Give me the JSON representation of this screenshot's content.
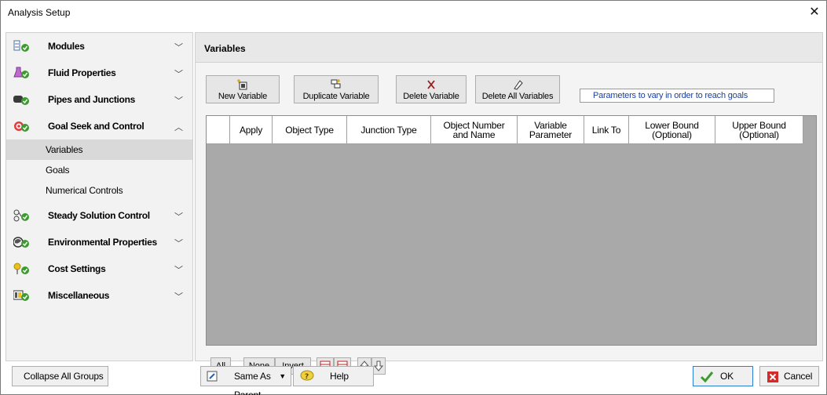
{
  "window": {
    "title": "Analysis Setup"
  },
  "sidebar": {
    "groups": [
      {
        "label": "Modules",
        "expanded": false
      },
      {
        "label": "Fluid Properties",
        "expanded": false
      },
      {
        "label": "Pipes and Junctions",
        "expanded": false
      },
      {
        "label": "Goal Seek and Control",
        "expanded": true
      },
      {
        "label": "Steady Solution Control",
        "expanded": false
      },
      {
        "label": "Environmental Properties",
        "expanded": false
      },
      {
        "label": "Cost Settings",
        "expanded": false
      },
      {
        "label": "Miscellaneous",
        "expanded": false
      }
    ],
    "sub_items": [
      {
        "label": "Variables",
        "selected": true
      },
      {
        "label": "Goals",
        "selected": false
      },
      {
        "label": "Numerical Controls",
        "selected": false
      }
    ]
  },
  "panel": {
    "title": "Variables",
    "toolbar": {
      "new_variable": "New Variable",
      "duplicate_variable": "Duplicate Variable",
      "delete_variable": "Delete Variable",
      "delete_all_variables": "Delete All Variables"
    },
    "hint": "Parameters to vary in order to reach goals",
    "table": {
      "columns": [
        "",
        "Apply",
        "Object Type",
        "Junction Type",
        "Object Number\nand Name",
        "Variable\nParameter",
        "Link To",
        "Lower Bound\n(Optional)",
        "Upper Bound\n(Optional)"
      ],
      "rows": []
    },
    "bottom_bar": {
      "all": "All",
      "none": "None",
      "invert": "Invert"
    }
  },
  "footer": {
    "collapse_all": "Collapse All Groups",
    "same_as_parent": "Same As Parent",
    "help": "Help",
    "ok": "OK",
    "cancel": "Cancel"
  },
  "colors": {
    "hint_text": "#1a3fa0",
    "grid_empty": "#a9a9a9",
    "ok_check": "#3c9b2e",
    "cancel_red": "#d42a2a"
  }
}
